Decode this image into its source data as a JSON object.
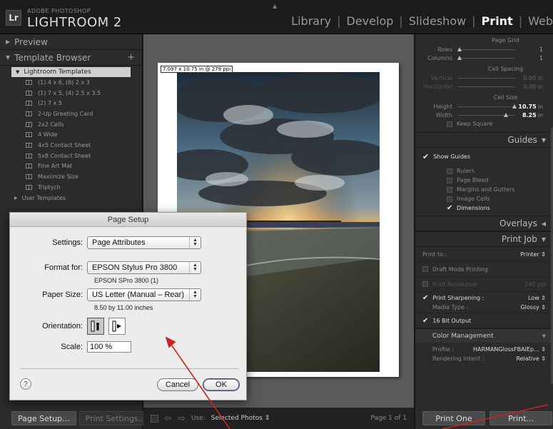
{
  "app": {
    "logo": "Lr",
    "brand_small": "ADOBE PHOTOSHOP",
    "brand_big": "LIGHTROOM 2",
    "modules": [
      "Library",
      "Develop",
      "Slideshow",
      "Print",
      "Web"
    ],
    "active_module": "Print"
  },
  "left": {
    "preview_label": "Preview",
    "template_browser_label": "Template Browser",
    "folder_label": "Lightroom Templates",
    "templates": [
      "(1) 4 x 6, (6) 2 x 3",
      "(1) 7 x 5, (4) 2.5 x 3.5",
      "(2) 7 x 5",
      "2-Up Greeting Card",
      "2x2 Cells",
      "4 Wide",
      "4x5 Contact Sheet",
      "5x8 Contact Sheet",
      "Fine Art Mat",
      "Maximize Size",
      "Triptych"
    ],
    "user_templates_label": "User Templates",
    "page_setup_button": "Page Setup...",
    "print_settings_button": "Print Settings..."
  },
  "center": {
    "dims_label": "7.097 x 10.75 in @ 279 ppi",
    "use_label": "Use:",
    "use_value": "Selected Photos",
    "page_info": "Page 1 of 1"
  },
  "right": {
    "page_grid": {
      "title": "Page Grid",
      "rows_label": "Rows",
      "rows_value": "1",
      "columns_label": "Columns",
      "columns_value": "1"
    },
    "cell_spacing": {
      "title": "Cell Spacing",
      "vertical_label": "Vertical",
      "vertical_value": "0.00",
      "horizontal_label": "Horizontal",
      "horizontal_value": "0.00",
      "unit": "in"
    },
    "cell_size": {
      "title": "Cell Size",
      "height_label": "Height",
      "height_value": "10.75",
      "width_label": "Width",
      "width_value": "8.25",
      "unit": "in",
      "keep_square_label": "Keep Square"
    },
    "guides": {
      "header": "Guides",
      "show_guides_label": "Show Guides",
      "options": [
        {
          "label": "Rulers",
          "checked": false
        },
        {
          "label": "Page Bleed",
          "checked": false
        },
        {
          "label": "Margins and Gutters",
          "checked": false
        },
        {
          "label": "Image Cells",
          "checked": false
        },
        {
          "label": "Dimensions",
          "checked": true
        }
      ]
    },
    "overlays_header": "Overlays",
    "print_job": {
      "header": "Print Job",
      "print_to_label": "Print to :",
      "print_to_value": "Printer",
      "draft_mode_label": "Draft Mode Printing",
      "print_resolution_label": "Print Resolution",
      "print_resolution_value": "240 ppi",
      "sharpening_label": "Print Sharpening :",
      "sharpening_value": "Low",
      "media_type_label": "Media Type :",
      "media_type_value": "Glossy",
      "bit_output_label": "16 Bit Output",
      "color_management_label": "Color Management",
      "profile_label": "Profile :",
      "profile_value": "HARMANGlossFBAIEp...",
      "rendering_label": "Rendering Intent :",
      "rendering_value": "Relative"
    },
    "print_one_button": "Print One",
    "print_button": "Print..."
  },
  "dialog": {
    "title": "Page Setup",
    "settings_label": "Settings:",
    "settings_value": "Page Attributes",
    "format_label": "Format for:",
    "format_value": "EPSON Stylus Pro 3800",
    "format_sub": "EPSON SPro 3800 (1)",
    "paper_label": "Paper Size:",
    "paper_value": "US Letter (Manual – Rear)",
    "paper_sub": "8.50 by 11.00 inches",
    "orientation_label": "Orientation:",
    "scale_label": "Scale:",
    "scale_value": "100 %",
    "help": "?",
    "cancel_button": "Cancel",
    "ok_button": "OK"
  },
  "colors": {
    "annotation_arrow": "#cc2222",
    "panel_bg": "#2b2b2b",
    "canvas_bg": "#5a5a5a"
  }
}
